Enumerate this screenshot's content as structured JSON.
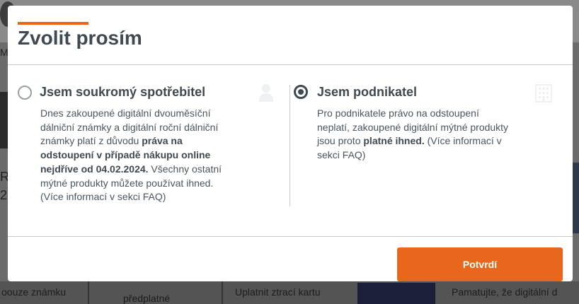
{
  "dialog": {
    "title": "Zvolit prosím",
    "options": [
      {
        "title": "Jsem soukromý spotřebitel",
        "icon": "person-icon",
        "selected": false,
        "text": [
          {
            "t": "Dnes zakoupené digitální dvouměsíční dálniční známky a digitální roční dálniční známky platí z důvodu ",
            "b": false
          },
          {
            "t": "práva na odstoupení v případě nákupu online nejdříve od 04.02.2024.",
            "b": true
          },
          {
            "t": " Všechny ostatní mýtné produkty můžete používat ihned. (Více informací v sekci FAQ)",
            "b": false
          }
        ]
      },
      {
        "title": "Jsem podnikatel",
        "icon": "building-icon",
        "selected": true,
        "text": [
          {
            "t": "Pro podnikatele právo na odstoupení neplatí, zakoupené digitální mýtné produkty jsou proto ",
            "b": false
          },
          {
            "t": "platné ihned.",
            "b": true
          },
          {
            "t": " (Více informací v sekci FAQ)",
            "b": false
          }
        ]
      }
    ],
    "confirm_label": "Potvrdí"
  },
  "background": {
    "left_texts": [
      "Me",
      "R",
      "2"
    ],
    "bottom_texts": [
      "oouze známku",
      "předplatné",
      "Uplatnit ztrací kartu",
      "Pamatujte, že digitální d"
    ]
  },
  "colors": {
    "accent": "#e8671c",
    "heading": "#3f4952",
    "text": "#4a5560"
  }
}
